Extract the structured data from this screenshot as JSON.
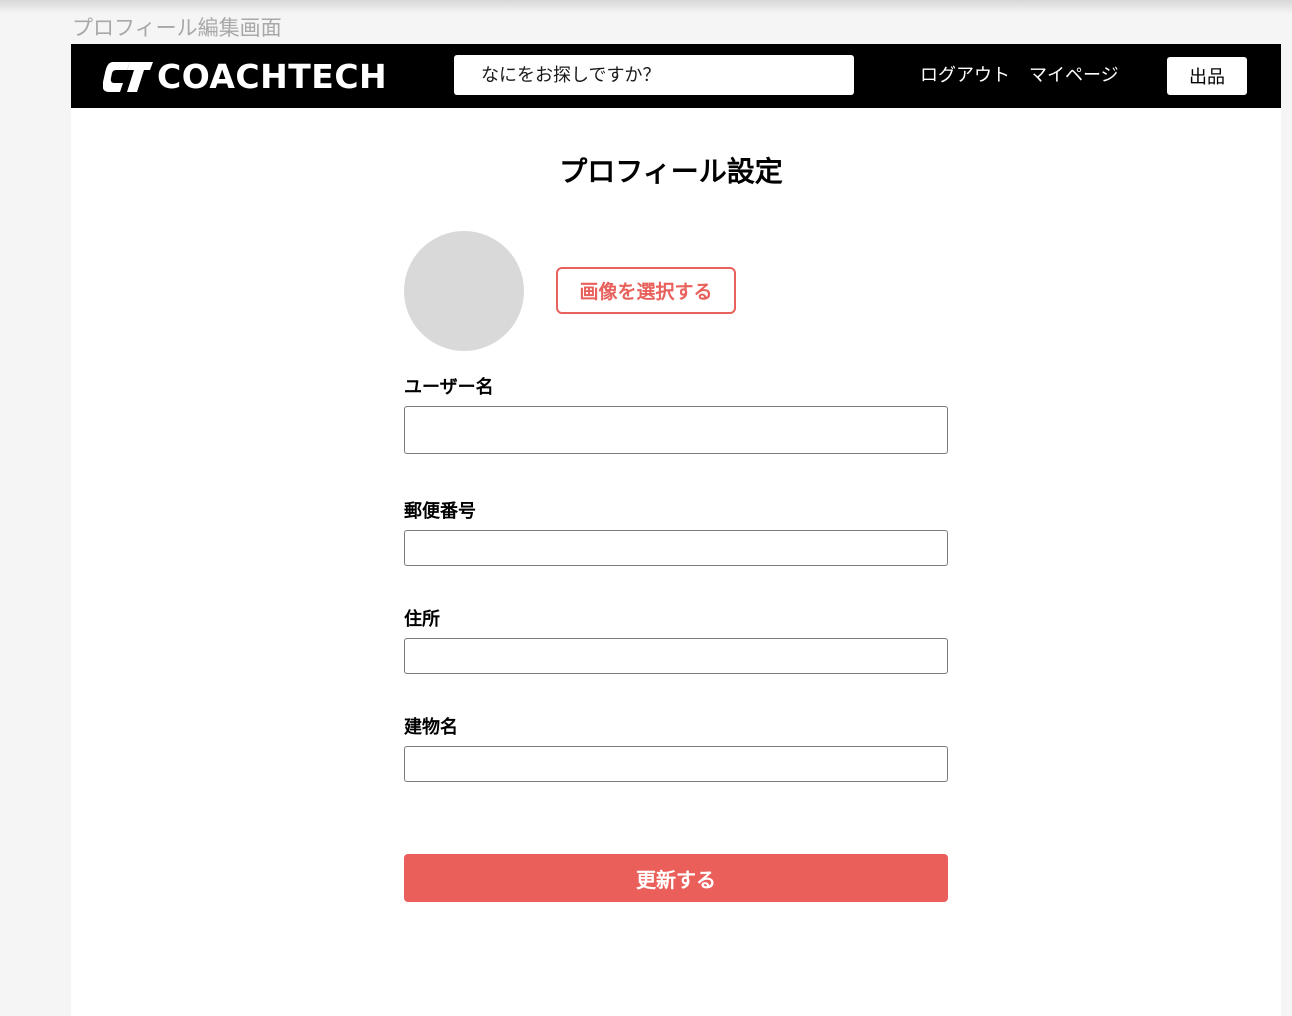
{
  "frame_label": "プロフィール編集画面",
  "header": {
    "logo_text": "COACHTECH",
    "search_placeholder": "なにをお探しですか？",
    "nav": {
      "logout": "ログアウト",
      "mypage": "マイページ",
      "sell": "出品"
    }
  },
  "main": {
    "title": "プロフィール設定",
    "select_image_label": "画像を選択する",
    "fields": [
      {
        "label": "ユーザー名",
        "value": ""
      },
      {
        "label": "郵便番号",
        "value": ""
      },
      {
        "label": "住所",
        "value": ""
      },
      {
        "label": "建物名",
        "value": ""
      }
    ],
    "submit_label": "更新する"
  },
  "colors": {
    "accent": "#eb5f5a",
    "header_bg": "#000000",
    "avatar_placeholder": "#d9d9d9"
  }
}
